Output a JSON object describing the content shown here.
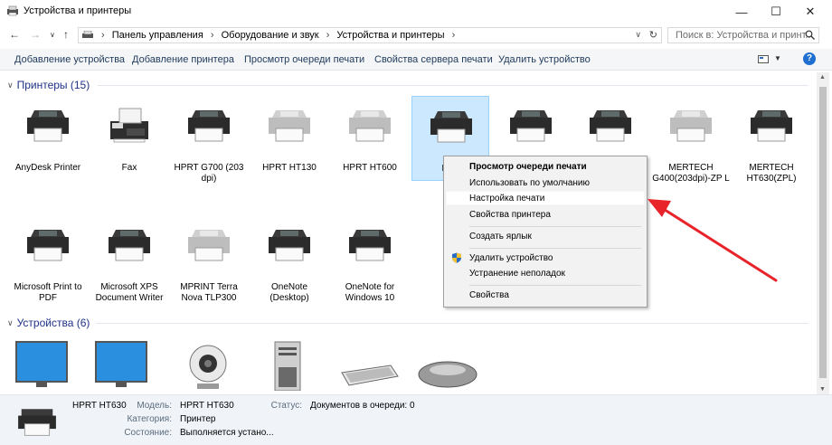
{
  "window": {
    "title": "Устройства и принтеры",
    "min": "—",
    "max": "☐",
    "close": "✕"
  },
  "address": {
    "crumbs": [
      "Панель управления",
      "Оборудование и звук",
      "Устройства и принтеры"
    ],
    "search_placeholder": "Поиск в: Устройства и принт..."
  },
  "toolbar": {
    "add_device": "Добавление устройства",
    "add_printer": "Добавление принтера",
    "view_queue": "Просмотр очереди печати",
    "server_props": "Свойства сервера печати",
    "remove_device": "Удалить устройство",
    "help": "?"
  },
  "printers": {
    "header": "Принтеры (15)",
    "items": [
      {
        "label": "AnyDesk Printer",
        "kind": "mfp"
      },
      {
        "label": "Fax",
        "kind": "fax"
      },
      {
        "label": "HPRT G700 (203 dpi)",
        "kind": "mfp"
      },
      {
        "label": "HPRT HT130",
        "kind": "mfp-gray"
      },
      {
        "label": "HPRT HT600",
        "kind": "mfp-gray"
      },
      {
        "label": "HPR",
        "kind": "mfp"
      },
      {
        "label": "",
        "kind": "mfp"
      },
      {
        "label": "",
        "kind": "mfp"
      },
      {
        "label": "MERTECH G400(203dpi)-ZP L",
        "kind": "mfp-gray"
      },
      {
        "label": "MERTECH HT630(ZPL)",
        "kind": "mfp"
      },
      {
        "label": "Microsoft Print to PDF",
        "kind": "mfp"
      },
      {
        "label": "Microsoft XPS Document Writer",
        "kind": "mfp"
      },
      {
        "label": "MPRINT Terra Nova TLP300",
        "kind": "mfp-gray"
      },
      {
        "label": "OneNote (Desktop)",
        "kind": "mfp"
      },
      {
        "label": "OneNote for Windows 10",
        "kind": "mfp"
      }
    ]
  },
  "devices": {
    "header": "Устройства (6)",
    "items": [
      "monitor",
      "monitor",
      "webcam",
      "computer",
      "keyboard",
      "mouse"
    ]
  },
  "context_menu": {
    "items": [
      "Просмотр очереди печати",
      "Использовать по умолчанию",
      "Настройка печати",
      "Свойства принтера",
      "Создать ярлык",
      "Удалить устройство",
      "Устранение неполадок",
      "Свойства"
    ]
  },
  "details": {
    "name": "HPRT HT630",
    "model_key": "Модель:",
    "model_val": "HPRT HT630",
    "category_key": "Категория:",
    "category_val": "Принтер",
    "state_key": "Состояние:",
    "state_val": "Выполняется устано...",
    "status_key": "Статус:",
    "status_val": "Документов в очереди: 0"
  },
  "colors": {
    "arrow": "#e8232a",
    "selection": "#cce8ff",
    "link": "#1e395b"
  }
}
